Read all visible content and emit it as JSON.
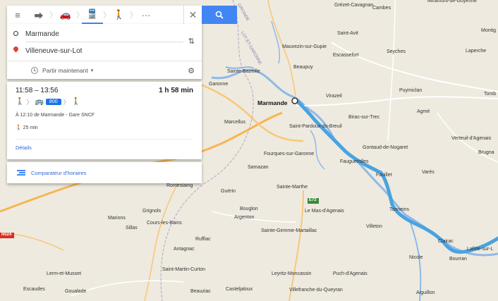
{
  "map": {
    "places": [
      {
        "name": "Marmande",
        "big": true
      },
      {
        "name": "Cambes"
      },
      {
        "name": "Miramont-de-Guyenne"
      },
      {
        "name": "Saint-Avit"
      },
      {
        "name": "Montig"
      },
      {
        "name": "Mauvezin-sur-Gupie"
      },
      {
        "name": "Escassefort"
      },
      {
        "name": "Seyches"
      },
      {
        "name": "Laperche"
      },
      {
        "name": "Beaupuy"
      },
      {
        "name": "Sainte-Bazeille"
      },
      {
        "name": "Puymiclan"
      },
      {
        "name": "Tomb"
      },
      {
        "name": "Virazeil"
      },
      {
        "name": "Garonne"
      },
      {
        "name": "Birac-sur-Trec"
      },
      {
        "name": "Agmé"
      },
      {
        "name": "Marcellus"
      },
      {
        "name": "Saint-Pardoux-du-Breuil"
      },
      {
        "name": "Verteuil-d'Agenais"
      },
      {
        "name": "Gontaud-de-Nogaret"
      },
      {
        "name": "Brugna"
      },
      {
        "name": "Fourques-sur-Garonne"
      },
      {
        "name": "Fauguerolles"
      },
      {
        "name": "Samazan"
      },
      {
        "name": "Fauillet"
      },
      {
        "name": "Varès"
      },
      {
        "name": "Romestaing"
      },
      {
        "name": "Guérin"
      },
      {
        "name": "Sainte-Marthe"
      },
      {
        "name": "Tonneins"
      },
      {
        "name": "Grignols"
      },
      {
        "name": "Bouglon"
      },
      {
        "name": "Marions"
      },
      {
        "name": "Argenton"
      },
      {
        "name": "Cours-les-Bains"
      },
      {
        "name": "Sillas"
      },
      {
        "name": "Villeton"
      },
      {
        "name": "Sainte-Gemme-Martaillac"
      },
      {
        "name": "Clairac"
      },
      {
        "name": "Lafitte-sur-L"
      },
      {
        "name": "Ruffiac"
      },
      {
        "name": "Antagnac"
      },
      {
        "name": "Bourran"
      },
      {
        "name": "Lerm-et-Musset"
      },
      {
        "name": "Saint-Martin-Curton"
      },
      {
        "name": "Leyritz-Moncassin"
      },
      {
        "name": "Puch-d'Agenais"
      },
      {
        "name": "Nicole"
      },
      {
        "name": "Escaudes"
      },
      {
        "name": "Goualade"
      },
      {
        "name": "Beauziac"
      },
      {
        "name": "Casteljaloux"
      },
      {
        "name": "Villefranche-du-Queyran"
      },
      {
        "name": "Aiguillon"
      },
      {
        "name": "Grézet-Cavagnan"
      },
      {
        "name": "Le Mas-d'Agenais"
      },
      {
        "name": "LOT-ET-GARONNE"
      },
      {
        "name": "GIRONDE"
      },
      {
        "name": "E72"
      },
      {
        "name": "N524"
      }
    ],
    "colors": {
      "route": "#4aa3df",
      "water": "#8fb9e8",
      "road": "#f5b651"
    }
  },
  "topbar": {
    "modes": [
      {
        "icon": "menu-icon",
        "glyph": "≡"
      },
      {
        "icon": "directions-icon",
        "glyph": "⮕"
      },
      {
        "icon": "car-icon",
        "glyph": "🚗"
      },
      {
        "icon": "transit-icon",
        "glyph": "🚆",
        "active": true
      },
      {
        "icon": "walk-icon",
        "glyph": "🚶"
      },
      {
        "icon": "more-icon",
        "glyph": "···"
      }
    ],
    "close_glyph": "✕"
  },
  "inputs": {
    "origin": "Marmande",
    "destination": "Villeneuve-sur-Lot",
    "swap_glyph": "⇅",
    "depart_label": "Partir maintenant",
    "depart_caret": "▾",
    "filter_glyph": "⚙"
  },
  "result": {
    "times": "11:58 – 13:56",
    "duration": "1 h 58 min",
    "walk_glyph": "🚶",
    "bus_glyph": "🚌",
    "line": "800",
    "departure": "À 12:10 de Marmande - Gare SNCF",
    "walk_time": "25 min",
    "details_label": "Détails"
  },
  "compare": {
    "label": "Comparateur d'horaires"
  }
}
